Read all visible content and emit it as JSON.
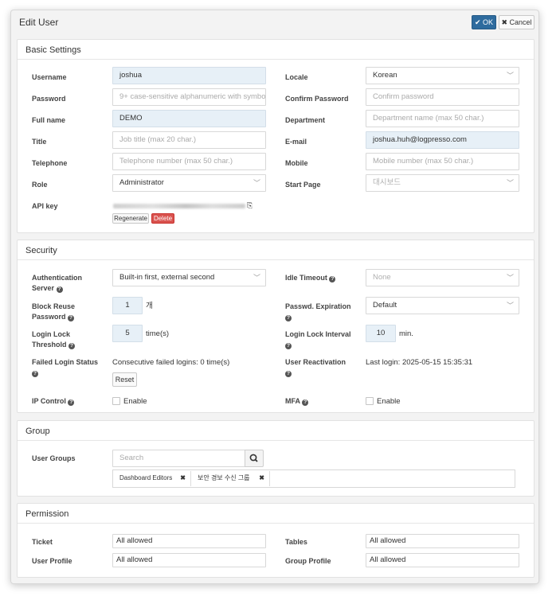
{
  "dialog": {
    "title": "Edit User",
    "ok_label": "OK",
    "cancel_label": "Cancel",
    "ok_icon": "checkmark-icon",
    "cancel_icon": "close-icon"
  },
  "basic": {
    "heading": "Basic Settings",
    "username": {
      "label": "Username",
      "value": "joshua"
    },
    "locale": {
      "label": "Locale",
      "value": "Korean"
    },
    "password": {
      "label": "Password",
      "placeholder": "9+ case-sensitive alphanumeric with symbo"
    },
    "confirm_password": {
      "label": "Confirm Password",
      "placeholder": "Confirm password"
    },
    "full_name": {
      "label": "Full name",
      "value": "DEMO"
    },
    "department": {
      "label": "Department",
      "placeholder": "Department name (max 50 char.)"
    },
    "title_field": {
      "label": "Title",
      "placeholder": "Job title (max 20 char.)"
    },
    "email": {
      "label": "E-mail",
      "value": "joshua.huh@logpresso.com"
    },
    "telephone": {
      "label": "Telephone",
      "placeholder": "Telephone number (max 50 char.)"
    },
    "mobile": {
      "label": "Mobile",
      "placeholder": "Mobile number (max 50 char.)"
    },
    "role": {
      "label": "Role",
      "value": "Administrator"
    },
    "start_page": {
      "label": "Start Page",
      "value": "대시보드"
    },
    "api_key": {
      "label": "API key",
      "copy_icon": "copy-icon",
      "regenerate_label": "Regenerate",
      "delete_label": "Delete"
    }
  },
  "security": {
    "heading": "Security",
    "auth_server": {
      "label_1": "Authentication",
      "label_2": "Server",
      "value": "Built-in first, external second"
    },
    "idle_timeout": {
      "label": "Idle Timeout",
      "value": "None"
    },
    "block_reuse": {
      "label_1": "Block Reuse",
      "label_2": "Password",
      "value": "1",
      "unit": "개"
    },
    "passwd_expiration": {
      "label_1": "Passwd. Expiration",
      "value": "Default"
    },
    "login_lock_threshold": {
      "label_1": "Login Lock",
      "label_2": "Threshold",
      "value": "5",
      "unit": "time(s)"
    },
    "login_lock_interval": {
      "label_1": "Login Lock Interval",
      "value": "10",
      "unit": "min."
    },
    "failed_login_status": {
      "label_1": "Failed Login Status",
      "text": "Consecutive failed logins: 0 time(s)",
      "reset_label": "Reset"
    },
    "user_reactivation": {
      "label_1": "User Reactivation",
      "text": "Last login: 2025-05-15 15:35:31"
    },
    "ip_control": {
      "label": "IP Control",
      "option": "Enable"
    },
    "mfa": {
      "label": "MFA",
      "option": "Enable"
    }
  },
  "group": {
    "heading": "Group",
    "user_groups": {
      "label": "User Groups",
      "search_placeholder": "Search",
      "search_icon": "search-icon",
      "tags": [
        "Dashboard Editors",
        "보안 경보 수신 그룹"
      ]
    }
  },
  "permission": {
    "heading": "Permission",
    "ticket": {
      "label": "Ticket",
      "value": "All allowed"
    },
    "tables": {
      "label": "Tables",
      "value": "All allowed"
    },
    "user_profile": {
      "label": "User Profile",
      "value": "All allowed"
    },
    "group_profile": {
      "label": "Group Profile",
      "value": "All allowed"
    }
  },
  "icons": {
    "help": "help-circle-icon",
    "chevron": "chevron-down-icon"
  }
}
